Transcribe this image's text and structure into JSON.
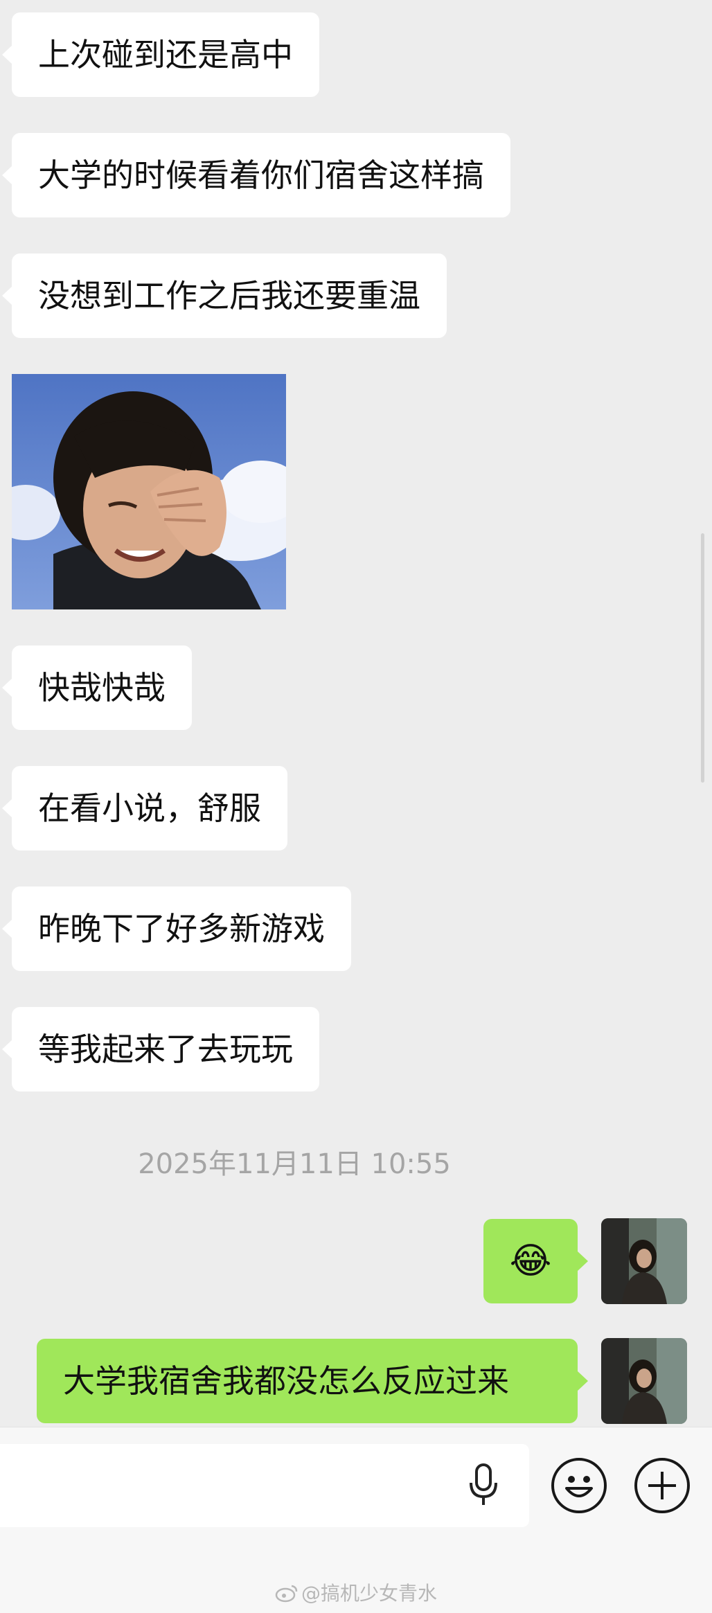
{
  "messages_received": [
    {
      "text": "上次碰到还是高中"
    },
    {
      "text": "大学的时候看着你们宿舍这样搞"
    },
    {
      "text": "没想到工作之后我还要重温"
    },
    {
      "text": "快哉快哉"
    },
    {
      "text": "在看小说，舒服"
    },
    {
      "text": "昨晚下了好多新游戏"
    },
    {
      "text": "等我起来了去玩玩"
    }
  ],
  "timestamp": "2025年11月11日 10:55",
  "messages_sent": [
    {
      "text": "😂",
      "icon": "facepalm-laugh-emoji"
    },
    {
      "text": "大学我宿舍我都没怎么反应过来"
    }
  ],
  "input": {
    "placeholder": ""
  },
  "watermark": "@搞机少女青水",
  "colors": {
    "background": "#ededed",
    "received_bubble": "#ffffff",
    "sent_bubble": "#a0e75a",
    "timestamp_text": "#a5a5a5"
  },
  "icons": {
    "voice": "microphone-icon",
    "emoji": "smiley-icon",
    "more": "plus-circle-icon",
    "weibo": "weibo-logo-icon"
  }
}
